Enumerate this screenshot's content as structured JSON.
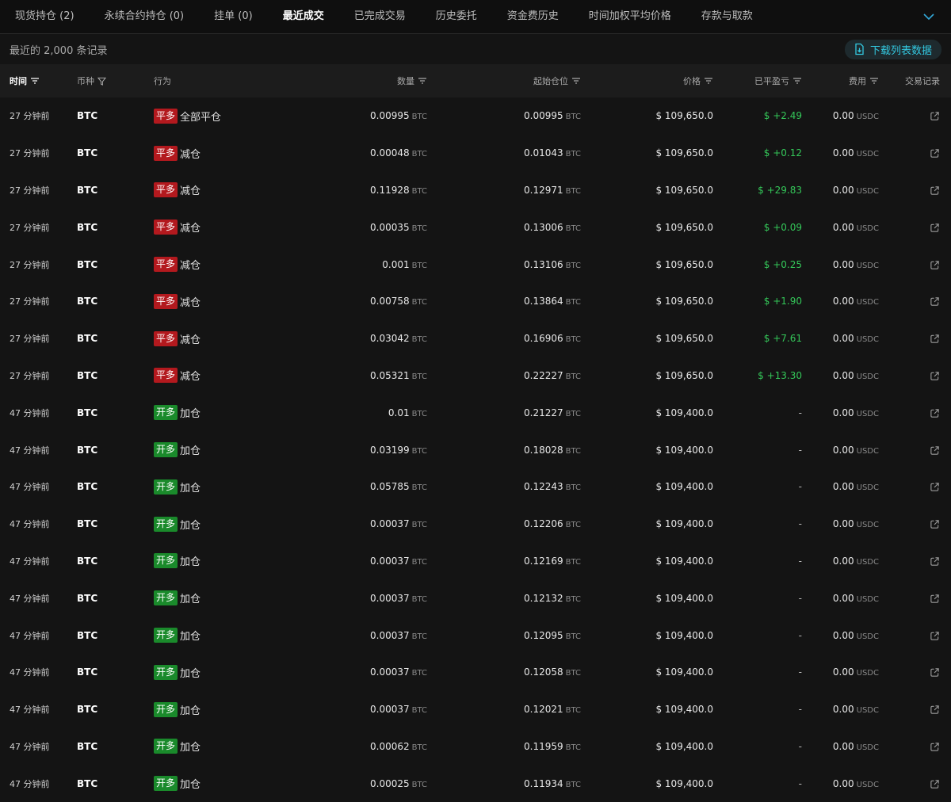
{
  "tabs": [
    {
      "label": "现货持仓 (2)",
      "active": false
    },
    {
      "label": "永续合约持仓 (0)",
      "active": false
    },
    {
      "label": "挂单 (0)",
      "active": false
    },
    {
      "label": "最近成交",
      "active": true
    },
    {
      "label": "已完成交易",
      "active": false
    },
    {
      "label": "历史委托",
      "active": false
    },
    {
      "label": "资金费历史",
      "active": false
    },
    {
      "label": "时间加权平均价格",
      "active": false
    },
    {
      "label": "存款与取款",
      "active": false
    }
  ],
  "subbar": {
    "record_count": "最近的 2,000 条记录",
    "download_label": "下载列表数据"
  },
  "columns": {
    "time": "时间",
    "coin": "币种",
    "action": "行为",
    "qty": "数量",
    "start_pos": "起始仓位",
    "price": "价格",
    "pnl": "已平盈亏",
    "fee": "费用",
    "record": "交易记录"
  },
  "colors": {
    "close_badge": "#b3191e",
    "open_badge": "#1a8a2b",
    "positive": "#34c759",
    "accent": "#33c8e0"
  },
  "rows": [
    {
      "time": "27 分钟前",
      "coin": "BTC",
      "side": "平多",
      "side_type": "close",
      "action": "全部平仓",
      "qty": "0.00995",
      "qty_unit": "BTC",
      "start": "0.00995",
      "start_unit": "BTC",
      "price": "$ 109,650.0",
      "pnl": "$ +2.49",
      "fee": "0.00",
      "fee_unit": "USDC"
    },
    {
      "time": "27 分钟前",
      "coin": "BTC",
      "side": "平多",
      "side_type": "close",
      "action": "减仓",
      "qty": "0.00048",
      "qty_unit": "BTC",
      "start": "0.01043",
      "start_unit": "BTC",
      "price": "$ 109,650.0",
      "pnl": "$ +0.12",
      "fee": "0.00",
      "fee_unit": "USDC"
    },
    {
      "time": "27 分钟前",
      "coin": "BTC",
      "side": "平多",
      "side_type": "close",
      "action": "减仓",
      "qty": "0.11928",
      "qty_unit": "BTC",
      "start": "0.12971",
      "start_unit": "BTC",
      "price": "$ 109,650.0",
      "pnl": "$ +29.83",
      "fee": "0.00",
      "fee_unit": "USDC"
    },
    {
      "time": "27 分钟前",
      "coin": "BTC",
      "side": "平多",
      "side_type": "close",
      "action": "减仓",
      "qty": "0.00035",
      "qty_unit": "BTC",
      "start": "0.13006",
      "start_unit": "BTC",
      "price": "$ 109,650.0",
      "pnl": "$ +0.09",
      "fee": "0.00",
      "fee_unit": "USDC"
    },
    {
      "time": "27 分钟前",
      "coin": "BTC",
      "side": "平多",
      "side_type": "close",
      "action": "减仓",
      "qty": "0.001",
      "qty_unit": "BTC",
      "start": "0.13106",
      "start_unit": "BTC",
      "price": "$ 109,650.0",
      "pnl": "$ +0.25",
      "fee": "0.00",
      "fee_unit": "USDC"
    },
    {
      "time": "27 分钟前",
      "coin": "BTC",
      "side": "平多",
      "side_type": "close",
      "action": "减仓",
      "qty": "0.00758",
      "qty_unit": "BTC",
      "start": "0.13864",
      "start_unit": "BTC",
      "price": "$ 109,650.0",
      "pnl": "$ +1.90",
      "fee": "0.00",
      "fee_unit": "USDC"
    },
    {
      "time": "27 分钟前",
      "coin": "BTC",
      "side": "平多",
      "side_type": "close",
      "action": "减仓",
      "qty": "0.03042",
      "qty_unit": "BTC",
      "start": "0.16906",
      "start_unit": "BTC",
      "price": "$ 109,650.0",
      "pnl": "$ +7.61",
      "fee": "0.00",
      "fee_unit": "USDC"
    },
    {
      "time": "27 分钟前",
      "coin": "BTC",
      "side": "平多",
      "side_type": "close",
      "action": "减仓",
      "qty": "0.05321",
      "qty_unit": "BTC",
      "start": "0.22227",
      "start_unit": "BTC",
      "price": "$ 109,650.0",
      "pnl": "$ +13.30",
      "fee": "0.00",
      "fee_unit": "USDC"
    },
    {
      "time": "47 分钟前",
      "coin": "BTC",
      "side": "开多",
      "side_type": "open",
      "action": "加仓",
      "qty": "0.01",
      "qty_unit": "BTC",
      "start": "0.21227",
      "start_unit": "BTC",
      "price": "$ 109,400.0",
      "pnl": "-",
      "fee": "0.00",
      "fee_unit": "USDC"
    },
    {
      "time": "47 分钟前",
      "coin": "BTC",
      "side": "开多",
      "side_type": "open",
      "action": "加仓",
      "qty": "0.03199",
      "qty_unit": "BTC",
      "start": "0.18028",
      "start_unit": "BTC",
      "price": "$ 109,400.0",
      "pnl": "-",
      "fee": "0.00",
      "fee_unit": "USDC"
    },
    {
      "time": "47 分钟前",
      "coin": "BTC",
      "side": "开多",
      "side_type": "open",
      "action": "加仓",
      "qty": "0.05785",
      "qty_unit": "BTC",
      "start": "0.12243",
      "start_unit": "BTC",
      "price": "$ 109,400.0",
      "pnl": "-",
      "fee": "0.00",
      "fee_unit": "USDC"
    },
    {
      "time": "47 分钟前",
      "coin": "BTC",
      "side": "开多",
      "side_type": "open",
      "action": "加仓",
      "qty": "0.00037",
      "qty_unit": "BTC",
      "start": "0.12206",
      "start_unit": "BTC",
      "price": "$ 109,400.0",
      "pnl": "-",
      "fee": "0.00",
      "fee_unit": "USDC"
    },
    {
      "time": "47 分钟前",
      "coin": "BTC",
      "side": "开多",
      "side_type": "open",
      "action": "加仓",
      "qty": "0.00037",
      "qty_unit": "BTC",
      "start": "0.12169",
      "start_unit": "BTC",
      "price": "$ 109,400.0",
      "pnl": "-",
      "fee": "0.00",
      "fee_unit": "USDC"
    },
    {
      "time": "47 分钟前",
      "coin": "BTC",
      "side": "开多",
      "side_type": "open",
      "action": "加仓",
      "qty": "0.00037",
      "qty_unit": "BTC",
      "start": "0.12132",
      "start_unit": "BTC",
      "price": "$ 109,400.0",
      "pnl": "-",
      "fee": "0.00",
      "fee_unit": "USDC"
    },
    {
      "time": "47 分钟前",
      "coin": "BTC",
      "side": "开多",
      "side_type": "open",
      "action": "加仓",
      "qty": "0.00037",
      "qty_unit": "BTC",
      "start": "0.12095",
      "start_unit": "BTC",
      "price": "$ 109,400.0",
      "pnl": "-",
      "fee": "0.00",
      "fee_unit": "USDC"
    },
    {
      "time": "47 分钟前",
      "coin": "BTC",
      "side": "开多",
      "side_type": "open",
      "action": "加仓",
      "qty": "0.00037",
      "qty_unit": "BTC",
      "start": "0.12058",
      "start_unit": "BTC",
      "price": "$ 109,400.0",
      "pnl": "-",
      "fee": "0.00",
      "fee_unit": "USDC"
    },
    {
      "time": "47 分钟前",
      "coin": "BTC",
      "side": "开多",
      "side_type": "open",
      "action": "加仓",
      "qty": "0.00037",
      "qty_unit": "BTC",
      "start": "0.12021",
      "start_unit": "BTC",
      "price": "$ 109,400.0",
      "pnl": "-",
      "fee": "0.00",
      "fee_unit": "USDC"
    },
    {
      "time": "47 分钟前",
      "coin": "BTC",
      "side": "开多",
      "side_type": "open",
      "action": "加仓",
      "qty": "0.00062",
      "qty_unit": "BTC",
      "start": "0.11959",
      "start_unit": "BTC",
      "price": "$ 109,400.0",
      "pnl": "-",
      "fee": "0.00",
      "fee_unit": "USDC"
    },
    {
      "time": "47 分钟前",
      "coin": "BTC",
      "side": "开多",
      "side_type": "open",
      "action": "加仓",
      "qty": "0.00025",
      "qty_unit": "BTC",
      "start": "0.11934",
      "start_unit": "BTC",
      "price": "$ 109,400.0",
      "pnl": "-",
      "fee": "0.00",
      "fee_unit": "USDC"
    }
  ]
}
